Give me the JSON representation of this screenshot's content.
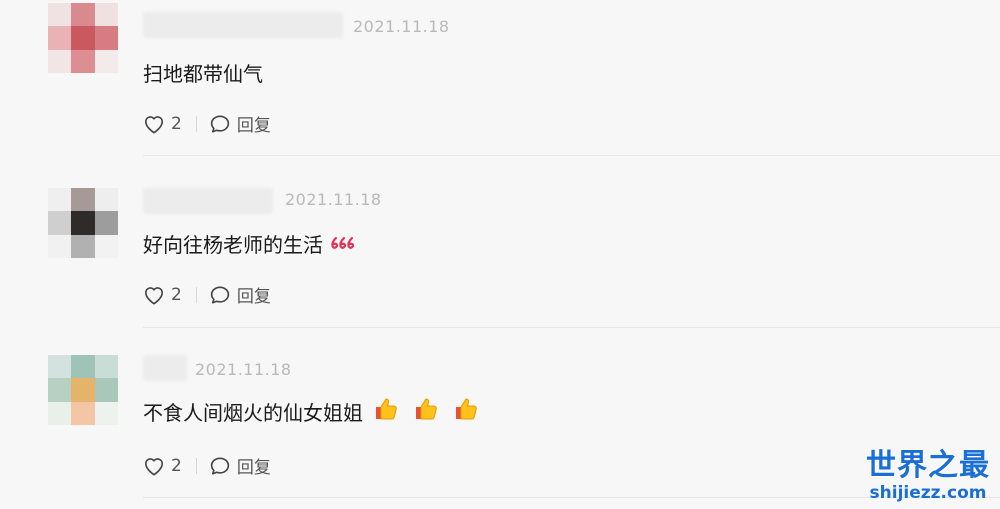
{
  "comments": [
    {
      "date": "2021.11.18",
      "text": "扫地都带仙气",
      "likes": "2",
      "reply_label": "回复",
      "emojis": []
    },
    {
      "date": "2021.11.18",
      "text": "好向往杨老师的生活",
      "likes": "2",
      "reply_label": "回复",
      "emojis": [
        "666"
      ]
    },
    {
      "date": "2021.11.18",
      "text": "不食人间烟火的仙女姐姐",
      "likes": "2",
      "reply_label": "回复",
      "emojis": [
        "thumbs-up",
        "thumbs-up",
        "thumbs-up"
      ]
    }
  ],
  "watermark": {
    "title": "世界之最",
    "url": "shijiezz.com"
  },
  "colors": {
    "background": "#f7f7f7",
    "date": "#b9b9b9",
    "watermark": "#1a6fd6"
  }
}
